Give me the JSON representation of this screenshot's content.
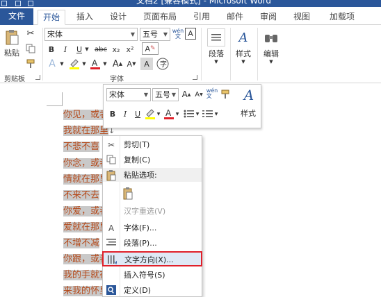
{
  "window": {
    "title": "文档2 [兼容模式] - Microsoft Word"
  },
  "tabs": {
    "file": "文件",
    "home": "开始",
    "insert": "插入",
    "design": "设计",
    "layout": "页面布局",
    "references": "引用",
    "mailings": "邮件",
    "review": "审阅",
    "view": "视图",
    "addins": "加载项"
  },
  "ribbon": {
    "paste_label": "粘贴",
    "clipboard_group": "剪贴板",
    "font_name": "宋体",
    "font_size": "五号",
    "phonetic_label": "wén\n文",
    "font_group": "字体",
    "bold": "B",
    "italic": "I",
    "underline": "U",
    "strike": "abc",
    "subscript": "x₂",
    "superscript": "x²",
    "paragraph_label": "段落",
    "styles_label": "样式",
    "editing_label": "编辑"
  },
  "document": {
    "lines": [
      "你见，或者",
      "我就在那里",
      "不悲不喜",
      "你念，或者",
      "情就在那里",
      "不来不去",
      "你爱，或者",
      "爱就在那里",
      "不增不减",
      "你跟，或者",
      "我的手就在",
      "来我的怀里"
    ]
  },
  "mini_toolbar": {
    "font_name": "宋体",
    "font_size": "五号",
    "styles_label": "样式",
    "bold": "B",
    "italic": "I",
    "underline": "U"
  },
  "context_menu": {
    "cut": "剪切(T)",
    "copy": "复制(C)",
    "paste_options": "粘贴选项:",
    "reconvert": "汉字重选(V)",
    "font": "字体(F)...",
    "paragraph": "段落(P)...",
    "text_direction": "文字方向(X)...",
    "insert_symbol": "插入符号(S)",
    "define": "定义(D)"
  },
  "colors": {
    "brand_blue": "#2b579a",
    "doc_text": "#b54a1b",
    "highlight_border": "#e0202a",
    "selection": "#c9c9c9"
  }
}
